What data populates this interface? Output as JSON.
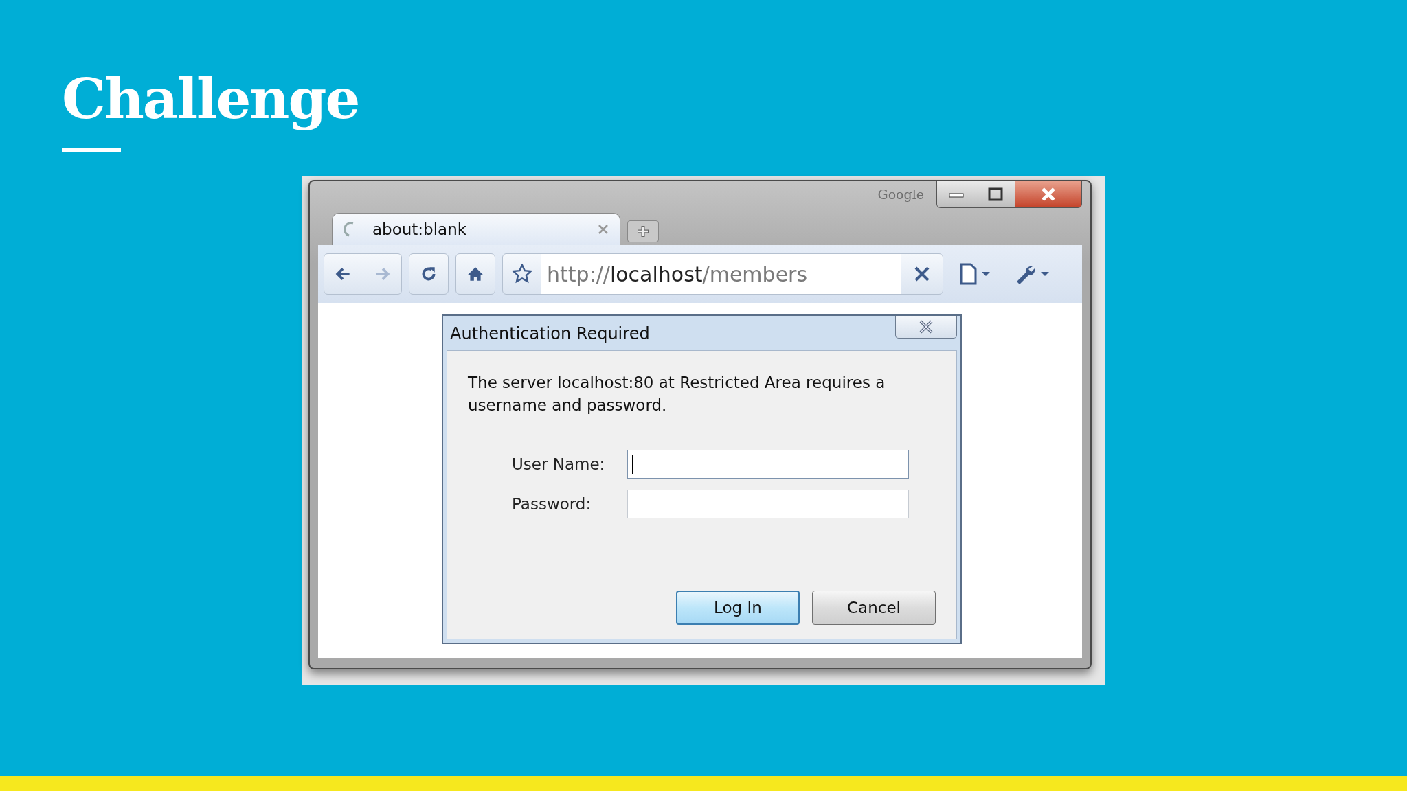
{
  "slide": {
    "title": "Challenge"
  },
  "browser": {
    "brand": "Google",
    "tabs": [
      {
        "title": "about:blank",
        "selected": true
      }
    ],
    "nav": [
      {
        "kind": "back",
        "disabled": false
      },
      {
        "kind": "forward",
        "disabled": true
      },
      {
        "kind": "reload",
        "disabled": false
      },
      {
        "kind": "home",
        "disabled": false
      }
    ],
    "address": {
      "scheme": "http://",
      "host": "localhost",
      "path": "/members"
    }
  },
  "dialog": {
    "title": "Authentication Required",
    "message": "The server localhost:80 at Restricted Area requires a username and password.",
    "fields": [
      {
        "label": "User Name:",
        "focused": true
      },
      {
        "label": "Password:",
        "focused": false
      }
    ],
    "buttons": [
      {
        "label": "Log In",
        "default": true
      },
      {
        "label": "Cancel",
        "default": false
      }
    ]
  }
}
